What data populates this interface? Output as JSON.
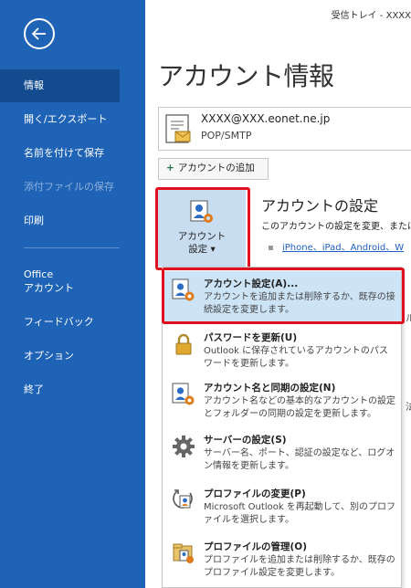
{
  "window": {
    "title": "受信トレイ - XXXX"
  },
  "sidebar": {
    "items": [
      {
        "label": "情報"
      },
      {
        "label": "開く/エクスポート"
      },
      {
        "label": "名前を付けて保存"
      },
      {
        "label": "添付ファイルの保存"
      },
      {
        "label": "印刷"
      },
      {
        "label_line1": "Office",
        "label_line2": "アカウント"
      },
      {
        "label": "フィードバック"
      },
      {
        "label": "オプション"
      },
      {
        "label": "終了"
      }
    ]
  },
  "main": {
    "title": "アカウント情報",
    "account": {
      "email": "XXXX@XXX.eonet.ne.jp",
      "type": "POP/SMTP"
    },
    "add_account_label": "アカウントの追加",
    "settings_button": {
      "line1": "アカウント",
      "line2": "設定 ▾"
    },
    "section": {
      "title": "アカウントの設定",
      "desc": "このアカウントの設定を変更、または追",
      "link": "iPhone、iPad、Android、W"
    },
    "behind": [
      "ル",
      "法"
    ]
  },
  "menu": {
    "items": [
      {
        "title": "アカウント設定(A)...",
        "desc": "アカウントを追加または削除するか、既存の接続設定を変更します。",
        "icon": "account-settings-icon"
      },
      {
        "title": "パスワードを更新(U)",
        "desc": "Outlook に保存されているアカウントのパスワードを更新します。",
        "icon": "lock-icon"
      },
      {
        "title": "アカウント名と同期の設定(N)",
        "desc": "アカウント名などの基本的なアカウントの設定とフォルダーの同期の設定を更新します。",
        "icon": "account-sync-icon"
      },
      {
        "title": "サーバーの設定(S)",
        "desc": "サーバー名、ポート、認証の設定など、ログオン情報を更新します。",
        "icon": "gear-icon"
      },
      {
        "title": "プロファイルの変更(P)",
        "desc": "Microsoft Outlook を再起動して、別のプロファイルを選択します。",
        "icon": "profile-change-icon"
      },
      {
        "title": "プロファイルの管理(O)",
        "desc": "プロファイルを追加または削除するか、既存のプロファイル設定を変更します。",
        "icon": "profile-manage-icon"
      }
    ]
  },
  "colors": {
    "sidebar": "#1f63b7",
    "sidebar_active": "#124c8f",
    "highlight": "#cde3f6",
    "annotation": "#e0101e"
  }
}
